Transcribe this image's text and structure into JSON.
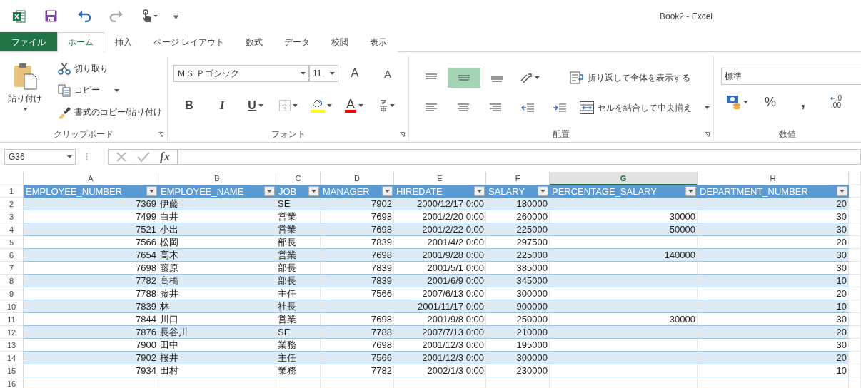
{
  "window": {
    "title": "Book2 - Excel"
  },
  "tabs": [
    {
      "label": "ファイル",
      "kind": "file",
      "selected": false
    },
    {
      "label": "ホーム",
      "kind": "tab",
      "selected": true
    },
    {
      "label": "挿入",
      "kind": "tab",
      "selected": false
    },
    {
      "label": "ページ レイアウト",
      "kind": "tab",
      "selected": false
    },
    {
      "label": "数式",
      "kind": "tab",
      "selected": false
    },
    {
      "label": "データ",
      "kind": "tab",
      "selected": false
    },
    {
      "label": "校閲",
      "kind": "tab",
      "selected": false
    },
    {
      "label": "表示",
      "kind": "tab",
      "selected": false
    }
  ],
  "ribbon": {
    "clipboard": {
      "label": "クリップボード",
      "paste": "貼り付け",
      "cut": "切り取り",
      "copy": "コピー",
      "format_painter": "書式のコピー/貼り付け"
    },
    "font": {
      "label": "フォント",
      "font_name": "ＭＳ Ｐゴシック",
      "font_size": "11",
      "grow": "A",
      "shrink": "A",
      "bold": "B",
      "italic": "I",
      "underline": "U",
      "font_color": "A"
    },
    "alignment": {
      "label": "配置",
      "vertical": [
        {
          "kind": "top",
          "selected": false
        },
        {
          "kind": "middle",
          "selected": true
        },
        {
          "kind": "bottom",
          "selected": false
        }
      ],
      "wrap_text": "折り返して全体を表示する",
      "merge": "セルを結合して中央揃え"
    },
    "number": {
      "label": "数値",
      "format": "標準",
      "percent": "%",
      "comma": ",",
      "decimal_top": ".0",
      "decimal_bottom": ".00"
    }
  },
  "formula_bar": {
    "name_box": "G36",
    "fx": "fx"
  },
  "grid": {
    "columns": [
      {
        "letter": "A",
        "selected": false
      },
      {
        "letter": "B",
        "selected": false
      },
      {
        "letter": "C",
        "selected": false
      },
      {
        "letter": "D",
        "selected": false
      },
      {
        "letter": "E",
        "selected": false
      },
      {
        "letter": "F",
        "selected": false
      },
      {
        "letter": "G",
        "selected": true
      },
      {
        "letter": "H",
        "selected": false
      }
    ],
    "headers": [
      "EMPLOYEE_NUMBER",
      "EMPLOYEE_NAME",
      "JOB",
      "MANAGER",
      "HIREDATE",
      "SALARY",
      "PERCENTAGE_SALARY",
      "DEPARTMENT_NUMBER"
    ],
    "rows": [
      {
        "number": "2",
        "cells": [
          "7369",
          "伊藤",
          "SE",
          "7902",
          "2000/12/17 0:00",
          "180000",
          null,
          "20"
        ]
      },
      {
        "number": "3",
        "cells": [
          "7499",
          "白井",
          "営業",
          "7698",
          "2001/2/20 0:00",
          "260000",
          "30000",
          "30"
        ]
      },
      {
        "number": "4",
        "cells": [
          "7521",
          "小出",
          "営業",
          "7698",
          "2001/2/22 0:00",
          "225000",
          "50000",
          "30"
        ]
      },
      {
        "number": "5",
        "cells": [
          "7566",
          "松岡",
          "部長",
          "7839",
          "2001/4/2 0:00",
          "297500",
          null,
          "20"
        ]
      },
      {
        "number": "6",
        "cells": [
          "7654",
          "高木",
          "営業",
          "7698",
          "2001/9/28 0:00",
          "225000",
          "140000",
          "30"
        ]
      },
      {
        "number": "7",
        "cells": [
          "7698",
          "藤原",
          "部長",
          "7839",
          "2001/5/1 0:00",
          "385000",
          null,
          "30"
        ]
      },
      {
        "number": "8",
        "cells": [
          "7782",
          "高橋",
          "部長",
          "7839",
          "2001/6/9 0:00",
          "345000",
          null,
          "10"
        ]
      },
      {
        "number": "9",
        "cells": [
          "7788",
          "藤井",
          "主任",
          "7566",
          "2007/6/13 0:00",
          "300000",
          null,
          "20"
        ]
      },
      {
        "number": "10",
        "cells": [
          "7839",
          "林",
          "社長",
          null,
          "2001/11/17 0:00",
          "900000",
          null,
          "10"
        ]
      },
      {
        "number": "11",
        "cells": [
          "7844",
          "川口",
          "営業",
          "7698",
          "2001/9/8 0:00",
          "250000",
          "30000",
          "30"
        ]
      },
      {
        "number": "12",
        "cells": [
          "7876",
          "長谷川",
          "SE",
          "7788",
          "2007/7/13 0:00",
          "210000",
          null,
          "20"
        ]
      },
      {
        "number": "13",
        "cells": [
          "7900",
          "田中",
          "業務",
          "7698",
          "2001/12/3 0:00",
          "195000",
          null,
          "30"
        ]
      },
      {
        "number": "14",
        "cells": [
          "7902",
          "桜井",
          "主任",
          "7566",
          "2001/12/3 0:00",
          "300000",
          null,
          "20"
        ]
      },
      {
        "number": "15",
        "cells": [
          "7934",
          "田村",
          "業務",
          "7782",
          "2002/1/3 0:00",
          "230000",
          null,
          "10"
        ]
      }
    ],
    "header_row_number": "1",
    "empty_row_numbers": [
      "16"
    ]
  }
}
